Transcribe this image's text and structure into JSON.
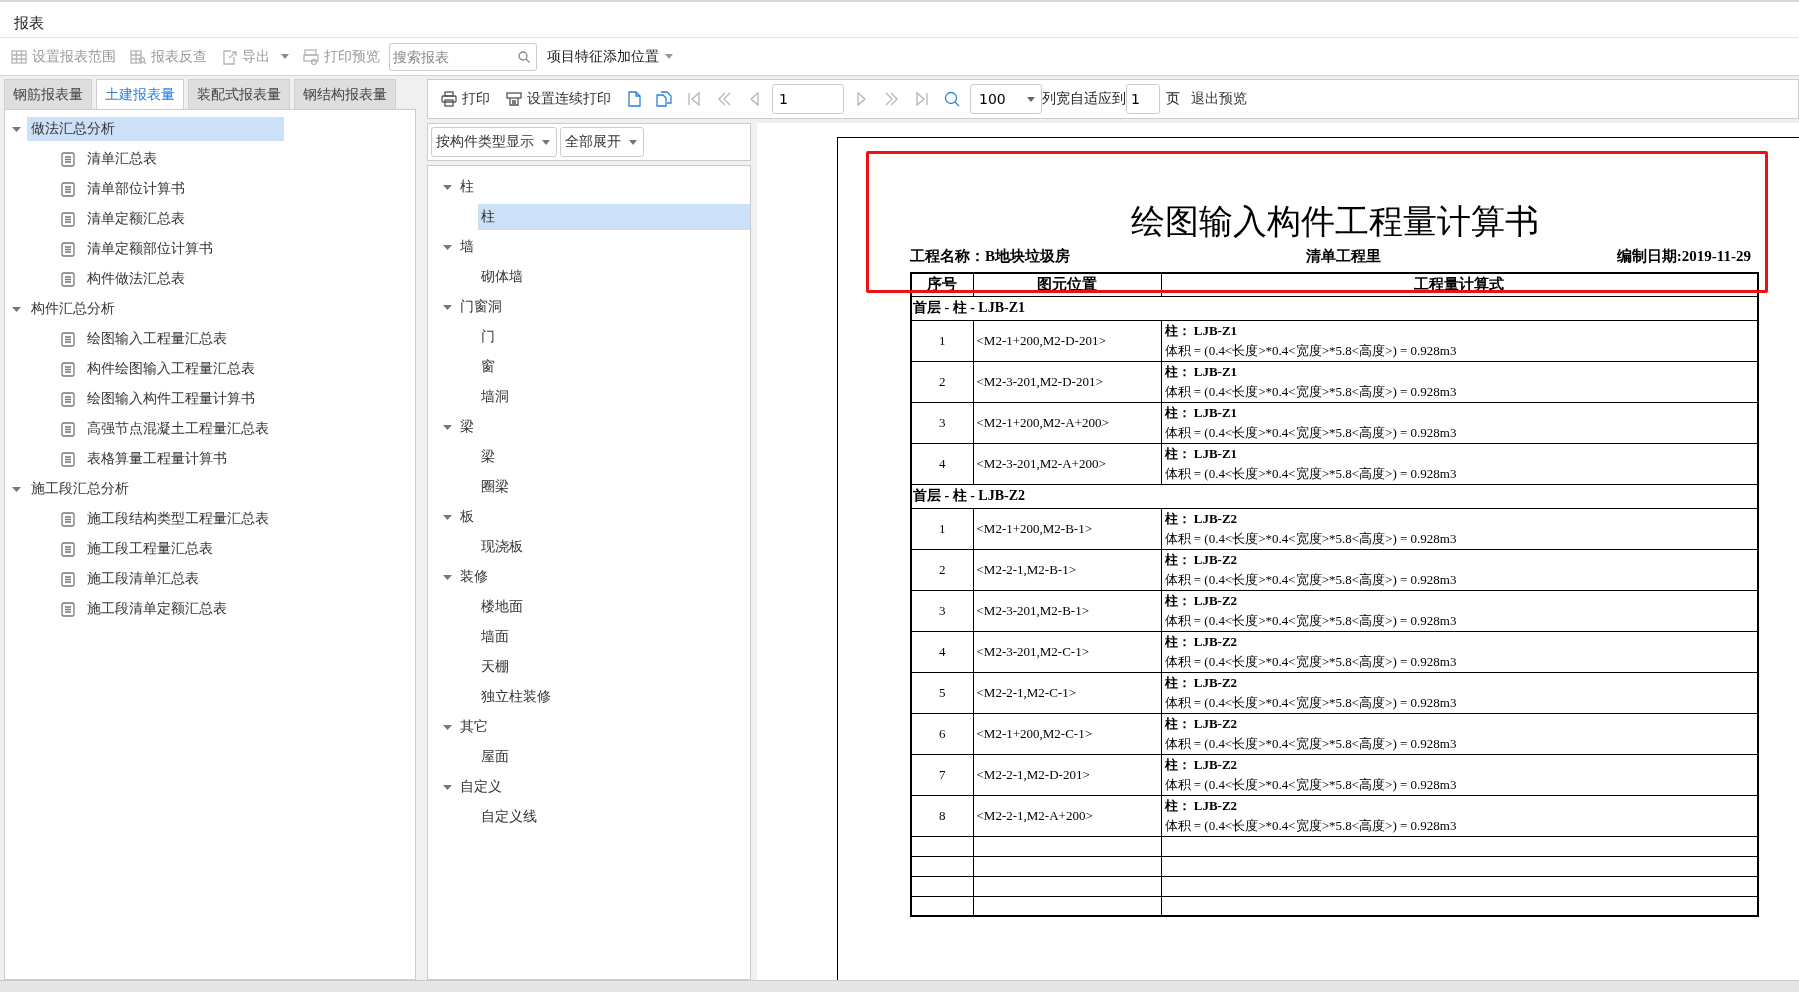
{
  "window": {
    "title": "报表"
  },
  "toolbar": {
    "items": [
      {
        "kind": "range",
        "label": "设置报表范围",
        "disabled": true,
        "menu": false
      },
      {
        "kind": "reverse",
        "label": "报表反查",
        "disabled": true,
        "menu": false
      },
      {
        "kind": "export",
        "label": "导出",
        "disabled": true,
        "menu": true
      },
      {
        "kind": "preview",
        "label": "打印预览",
        "disabled": true,
        "menu": false
      }
    ],
    "search": {
      "placeholder": "搜索报表"
    },
    "dropdown": {
      "value": "项目特征添加位置"
    }
  },
  "tabs": [
    {
      "label": "钢筋报表量",
      "selected": false
    },
    {
      "label": "土建报表量",
      "selected": true
    },
    {
      "label": "装配式报表量",
      "selected": false
    },
    {
      "label": "钢结构报表量",
      "selected": false
    }
  ],
  "report_tree": [
    {
      "label": "做法汇总分析",
      "expanded": true,
      "selected": true,
      "children": [
        {
          "label": "清单汇总表",
          "selected": false
        },
        {
          "label": "清单部位计算书",
          "selected": false
        },
        {
          "label": "清单定额汇总表",
          "selected": false
        },
        {
          "label": "清单定额部位计算书",
          "selected": false
        },
        {
          "label": "构件做法汇总表",
          "selected": false
        }
      ]
    },
    {
      "label": "构件汇总分析",
      "expanded": true,
      "selected": false,
      "children": [
        {
          "label": "绘图输入工程量汇总表",
          "selected": false
        },
        {
          "label": "构件绘图输入工程量汇总表",
          "selected": false
        },
        {
          "label": "绘图输入构件工程量计算书",
          "selected": false
        },
        {
          "label": "高强节点混凝土工程量汇总表",
          "selected": false
        },
        {
          "label": "表格算量工程量计算书",
          "selected": false
        }
      ]
    },
    {
      "label": "施工段汇总分析",
      "expanded": true,
      "selected": false,
      "children": [
        {
          "label": "施工段结构类型工程量汇总表",
          "selected": false
        },
        {
          "label": "施工段工程量汇总表",
          "selected": false
        },
        {
          "label": "施工段清单汇总表",
          "selected": false
        },
        {
          "label": "施工段清单定额汇总表",
          "selected": false
        }
      ]
    }
  ],
  "preview_toolbar": {
    "buttons": [
      {
        "kind": "print",
        "label": "打印",
        "disabled": false
      },
      {
        "kind": "print-setting",
        "label": "设置连续打印",
        "disabled": false
      },
      {
        "kind": "page",
        "disabled": false
      },
      {
        "kind": "pages",
        "disabled": false
      },
      {
        "kind": "first",
        "disabled": true
      },
      {
        "kind": "fast-prev",
        "disabled": true
      },
      {
        "kind": "prev",
        "disabled": true
      }
    ],
    "page": "1",
    "nav": [
      {
        "kind": "next",
        "disabled": true
      },
      {
        "kind": "fast-next",
        "disabled": true
      },
      {
        "kind": "last",
        "disabled": true
      },
      {
        "kind": "zoom",
        "disabled": false
      }
    ],
    "zoom": "100",
    "fit_label": "列宽自适应到",
    "fit_pages": "1",
    "pages_unit": "页",
    "exit": "退出预览"
  },
  "filter": {
    "display": "按构件类型显示",
    "expand": "全部展开"
  },
  "component_tree": [
    {
      "label": "柱",
      "expanded": true,
      "selected": false,
      "children": [
        {
          "label": "柱",
          "selected": true
        }
      ]
    },
    {
      "label": "墙",
      "expanded": true,
      "selected": false,
      "children": [
        {
          "label": "砌体墙",
          "selected": false
        }
      ]
    },
    {
      "label": "门窗洞",
      "expanded": true,
      "selected": false,
      "children": [
        {
          "label": "门",
          "selected": false
        },
        {
          "label": "窗",
          "selected": false
        },
        {
          "label": "墙洞",
          "selected": false
        }
      ]
    },
    {
      "label": "梁",
      "expanded": true,
      "selected": false,
      "children": [
        {
          "label": "梁",
          "selected": false
        },
        {
          "label": "圈梁",
          "selected": false
        }
      ]
    },
    {
      "label": "板",
      "expanded": true,
      "selected": false,
      "children": [
        {
          "label": "现浇板",
          "selected": false
        }
      ]
    },
    {
      "label": "装修",
      "expanded": true,
      "selected": false,
      "children": [
        {
          "label": "楼地面",
          "selected": false
        },
        {
          "label": "墙面",
          "selected": false
        },
        {
          "label": "天棚",
          "selected": false
        },
        {
          "label": "独立柱装修",
          "selected": false
        }
      ]
    },
    {
      "label": "其它",
      "expanded": true,
      "selected": false,
      "children": [
        {
          "label": "屋面",
          "selected": false
        }
      ]
    },
    {
      "label": "自定义",
      "expanded": true,
      "selected": false,
      "children": [
        {
          "label": "自定义线",
          "selected": false
        }
      ]
    }
  ],
  "document": {
    "title": "绘图输入构件工程量计算书",
    "project": "工程名称：B地块垃圾房",
    "subtitle": "清单工程里",
    "date": "编制日期:2019-11-29",
    "columns": [
      "序号",
      "图元位置",
      "工程量计算式"
    ],
    "groups": [
      {
        "title": "首层 - 柱 - LJB-Z1",
        "rows": [
          {
            "index": "1",
            "position": "<M2-1+200,M2-D-201>",
            "component": "柱： LJB-Z1",
            "formula": "体积 = (0.4<长度>*0.4<宽度>*5.8<高度>) = 0.928m3"
          },
          {
            "index": "2",
            "position": "<M2-3-201,M2-D-201>",
            "component": "柱： LJB-Z1",
            "formula": "体积 = (0.4<长度>*0.4<宽度>*5.8<高度>) = 0.928m3"
          },
          {
            "index": "3",
            "position": "<M2-1+200,M2-A+200>",
            "component": "柱： LJB-Z1",
            "formula": "体积 = (0.4<长度>*0.4<宽度>*5.8<高度>) = 0.928m3"
          },
          {
            "index": "4",
            "position": "<M2-3-201,M2-A+200>",
            "component": "柱： LJB-Z1",
            "formula": "体积 = (0.4<长度>*0.4<宽度>*5.8<高度>) = 0.928m3"
          }
        ]
      },
      {
        "title": "首层 - 柱 - LJB-Z2",
        "rows": [
          {
            "index": "1",
            "position": "<M2-1+200,M2-B-1>",
            "component": "柱： LJB-Z2",
            "formula": "体积 = (0.4<长度>*0.4<宽度>*5.8<高度>) = 0.928m3"
          },
          {
            "index": "2",
            "position": "<M2-2-1,M2-B-1>",
            "component": "柱： LJB-Z2",
            "formula": "体积 = (0.4<长度>*0.4<宽度>*5.8<高度>) = 0.928m3"
          },
          {
            "index": "3",
            "position": "<M2-3-201,M2-B-1>",
            "component": "柱： LJB-Z2",
            "formula": "体积 = (0.4<长度>*0.4<宽度>*5.8<高度>) = 0.928m3"
          },
          {
            "index": "4",
            "position": "<M2-3-201,M2-C-1>",
            "component": "柱： LJB-Z2",
            "formula": "体积 = (0.4<长度>*0.4<宽度>*5.8<高度>) = 0.928m3"
          },
          {
            "index": "5",
            "position": "<M2-2-1,M2-C-1>",
            "component": "柱： LJB-Z2",
            "formula": "体积 = (0.4<长度>*0.4<宽度>*5.8<高度>) = 0.928m3"
          },
          {
            "index": "6",
            "position": "<M2-1+200,M2-C-1>",
            "component": "柱： LJB-Z2",
            "formula": "体积 = (0.4<长度>*0.4<宽度>*5.8<高度>) = 0.928m3"
          },
          {
            "index": "7",
            "position": "<M2-2-1,M2-D-201>",
            "component": "柱： LJB-Z2",
            "formula": "体积 = (0.4<长度>*0.4<宽度>*5.8<高度>) = 0.928m3"
          },
          {
            "index": "8",
            "position": "<M2-2-1,M2-A+200>",
            "component": "柱： LJB-Z2",
            "formula": "体积 = (0.4<长度>*0.4<宽度>*5.8<高度>) = 0.928m3"
          }
        ]
      }
    ]
  }
}
